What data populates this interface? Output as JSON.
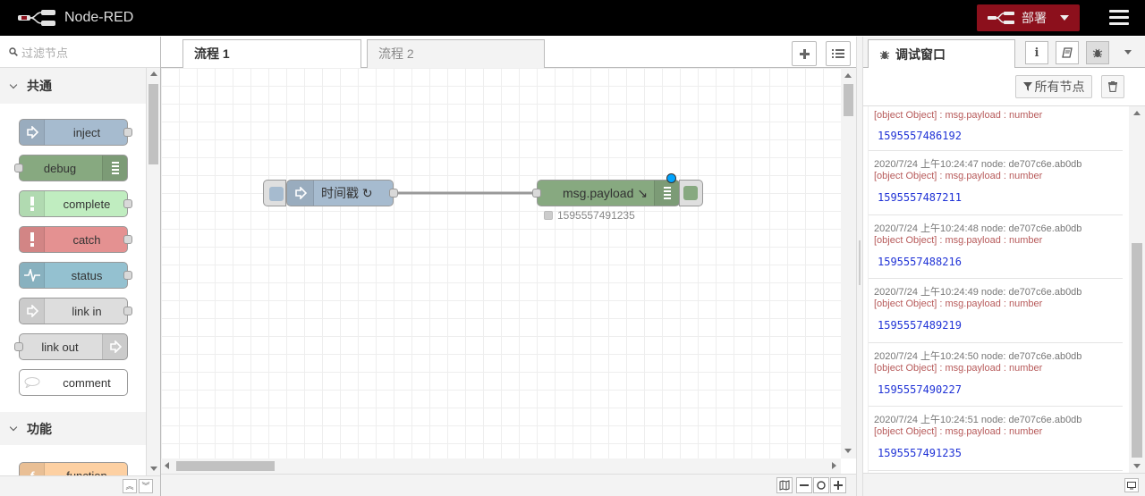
{
  "header": {
    "title": "Node-RED",
    "deploy_label": "部署"
  },
  "palette": {
    "search_placeholder": "过滤节点",
    "categories": [
      {
        "label": "共通"
      },
      {
        "label": "功能"
      }
    ],
    "nodes": [
      {
        "label": "inject",
        "color": "#a6bbcf"
      },
      {
        "label": "debug",
        "color": "#87a980"
      },
      {
        "label": "complete",
        "color": "#c0edc0"
      },
      {
        "label": "catch",
        "color": "#e49191"
      },
      {
        "label": "status",
        "color": "#94c1d0"
      },
      {
        "label": "link in",
        "color": "#dddddd"
      },
      {
        "label": "link out",
        "color": "#dddddd"
      },
      {
        "label": "comment",
        "color": "#ffffff"
      },
      {
        "label": "function",
        "color": "#fdd0a2"
      }
    ]
  },
  "workspace": {
    "tabs": [
      {
        "label": "流程 1",
        "active": true
      },
      {
        "label": "流程 2",
        "active": false
      }
    ],
    "flow_nodes": {
      "inject": {
        "label": "时间戳 ↻",
        "color": "#a6bbcf"
      },
      "debug": {
        "label": "msg.payload ↘",
        "color": "#87a980",
        "status": "1595557491235"
      }
    }
  },
  "sidebar": {
    "tab_label": "调试窗口",
    "filter_label": "所有节点",
    "messages": [
      {
        "meta": "",
        "topic": "[object Object] : msg.payload : number",
        "value": "1595557486192"
      },
      {
        "meta": "2020/7/24 上午10:24:47   node: de707c6e.ab0db",
        "topic": "[object Object] : msg.payload : number",
        "value": "1595557487211"
      },
      {
        "meta": "2020/7/24 上午10:24:48   node: de707c6e.ab0db",
        "topic": "[object Object] : msg.payload : number",
        "value": "1595557488216"
      },
      {
        "meta": "2020/7/24 上午10:24:49   node: de707c6e.ab0db",
        "topic": "[object Object] : msg.payload : number",
        "value": "1595557489219"
      },
      {
        "meta": "2020/7/24 上午10:24:50   node: de707c6e.ab0db",
        "topic": "[object Object] : msg.payload : number",
        "value": "1595557490227"
      },
      {
        "meta": "2020/7/24 上午10:24:51   node: de707c6e.ab0db",
        "topic": "[object Object] : msg.payload : number",
        "value": "1595557491235"
      }
    ]
  }
}
